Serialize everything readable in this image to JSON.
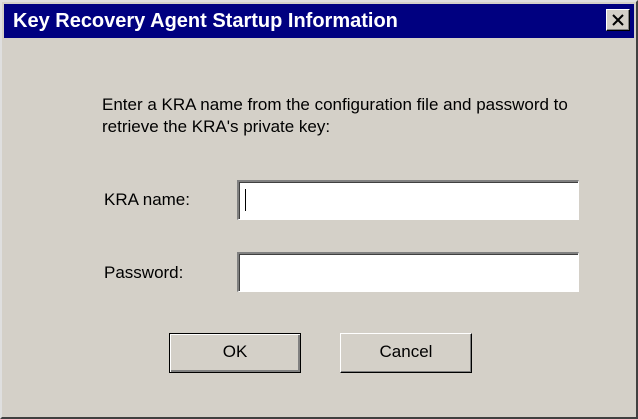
{
  "window": {
    "title": "Key Recovery Agent Startup Information"
  },
  "dialog": {
    "instructions": "Enter a KRA name from the configuration file and password to retrieve the KRA's private key:",
    "kra_name_label": "KRA name:",
    "kra_name_value": "",
    "password_label": "Password:",
    "password_value": "",
    "ok_label": "OK",
    "cancel_label": "Cancel"
  },
  "icons": {
    "close": "close-icon"
  },
  "colors": {
    "titlebar": "#000080",
    "face": "#d4d0c8"
  }
}
